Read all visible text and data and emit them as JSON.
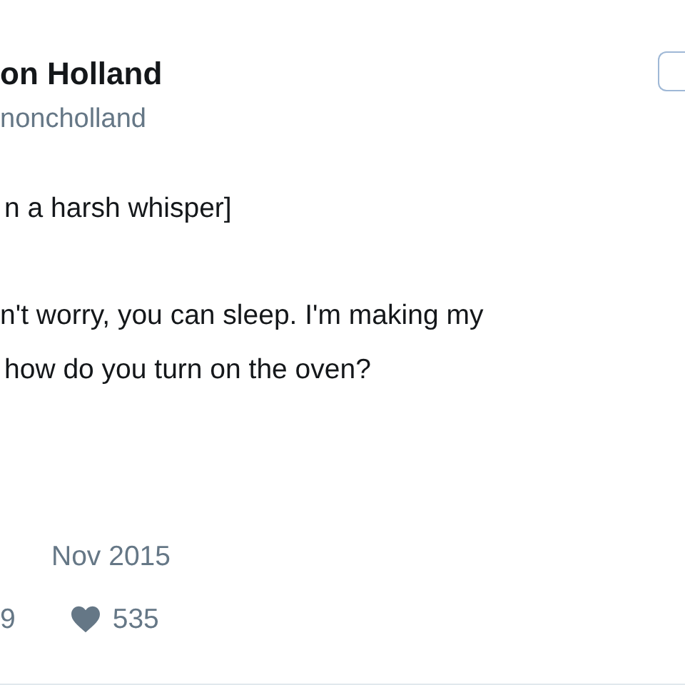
{
  "author": {
    "name": "on Holland",
    "handle": "noncholland"
  },
  "body": [
    "n a harsh whisper]",
    "n't worry, you can sleep. I'm making my",
    "how do you turn on the oven?"
  ],
  "date": "Nov 2015",
  "stats": {
    "retweets": "9",
    "likes": "535"
  }
}
